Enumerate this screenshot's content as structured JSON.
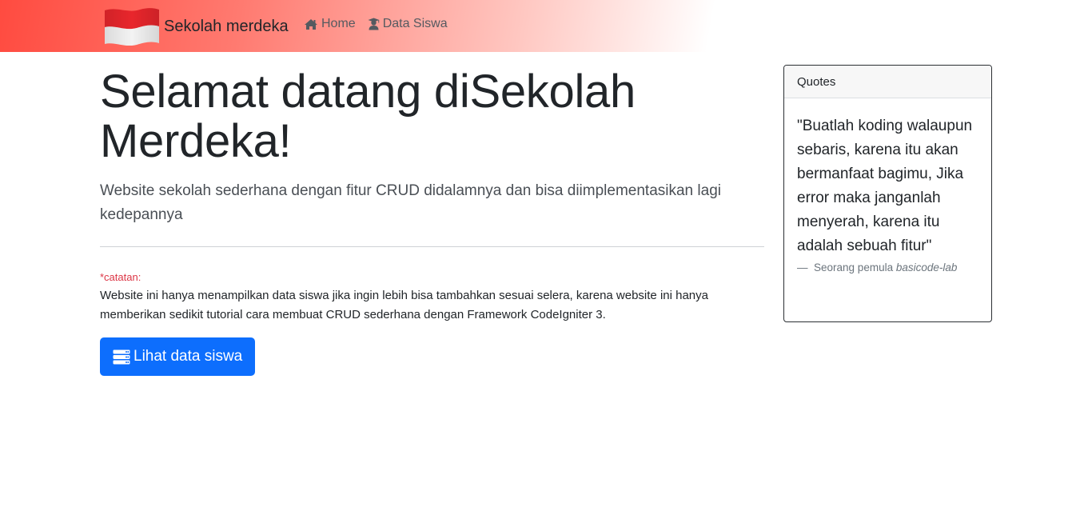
{
  "navbar": {
    "brand_label": "Sekolah merdeka",
    "links": [
      {
        "label": "Home",
        "icon": "home-icon"
      },
      {
        "label": "Data Siswa",
        "icon": "user-graduate-icon"
      }
    ],
    "gradient_color": "#ff4b40"
  },
  "main": {
    "title": "Selamat datang diSekolah Merdeka!",
    "lead": "Website sekolah sederhana dengan fitur CRUD didalamnya dan bisa diimplementasikan lagi kedepannya",
    "note_label": "*catatan:",
    "note_body": "Website ini hanya menampilkan data siswa jika ingin lebih bisa tambahkan sesuai selera, karena website ini hanya memberikan sedikit tutorial cara membuat CRUD sederhana dengan Framework CodeIgniter 3.",
    "button_label": "Lihat data siswa",
    "button_icon": "server-icon",
    "button_color": "#0d6efd"
  },
  "quotes": {
    "header": "Quotes",
    "text": "\"Buatlah koding walaupun sebaris, karena itu akan bermanfaat bagimu, Jika error maka janganlah menyerah, karena itu adalah sebuah fitur\"",
    "footer_dash": "—",
    "footer_author": "Seorang pemula",
    "footer_source": "basicode-lab"
  }
}
